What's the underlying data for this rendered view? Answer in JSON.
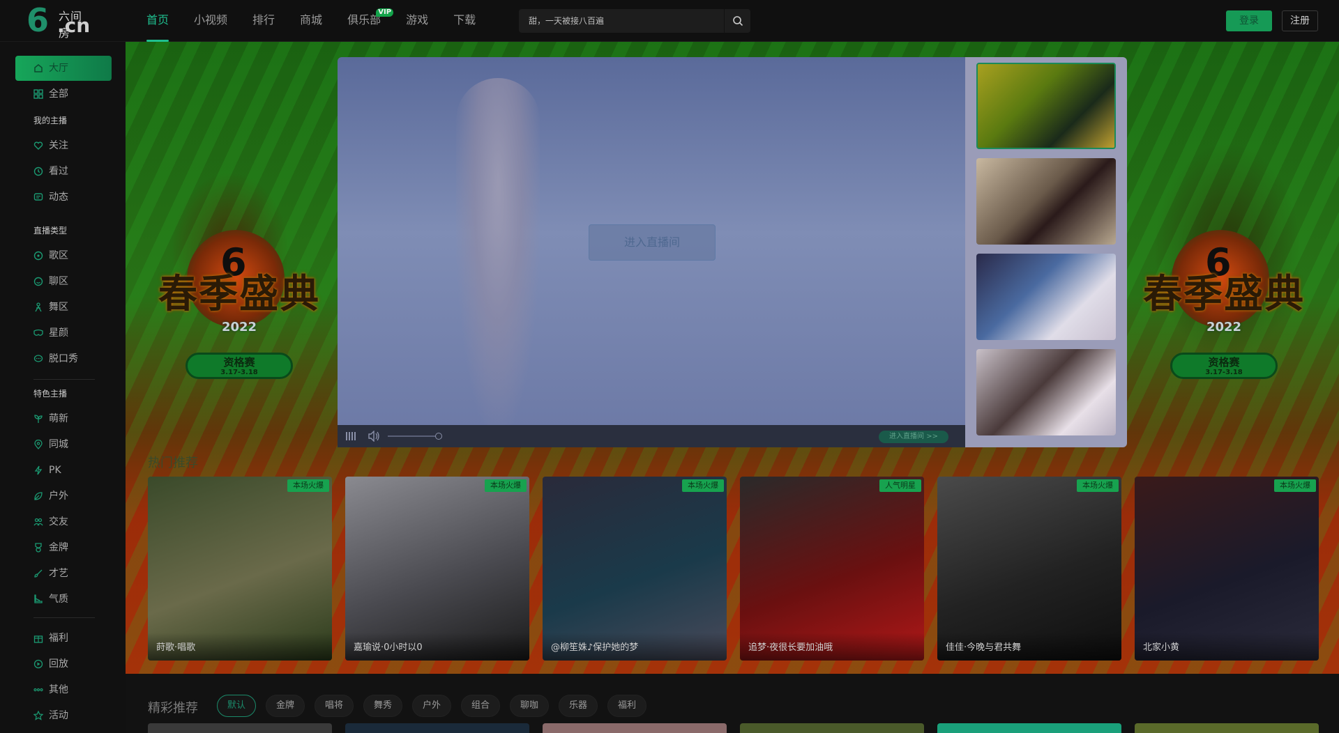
{
  "header": {
    "logo": {
      "top": "六间房",
      "bottom": "6.cn"
    },
    "nav": [
      {
        "label": "首页",
        "active": true
      },
      {
        "label": "小视频"
      },
      {
        "label": "排行"
      },
      {
        "label": "商城"
      },
      {
        "label": "俱乐部",
        "badge": "VIP"
      },
      {
        "label": "游戏"
      },
      {
        "label": "下载"
      }
    ],
    "search_placeholder": "甜，一天被接八百遍",
    "login_label": "登录",
    "register_label": "注册"
  },
  "sidebar": {
    "items_top": [
      {
        "label": "大厅",
        "icon": "home-icon",
        "active": true
      },
      {
        "label": "全部",
        "icon": "grid-icon"
      }
    ],
    "section_my": "我的主播",
    "items_my": [
      {
        "label": "关注",
        "icon": "heart-icon"
      },
      {
        "label": "看过",
        "icon": "clock-icon"
      },
      {
        "label": "动态",
        "icon": "chat-icon"
      }
    ],
    "section_type": "直播类型",
    "items_type": [
      {
        "label": "歌区",
        "icon": "music-disc-icon"
      },
      {
        "label": "聊区",
        "icon": "smile-icon"
      },
      {
        "label": "舞区",
        "icon": "dance-icon"
      },
      {
        "label": "星颜",
        "icon": "mask-icon"
      },
      {
        "label": "脱口秀",
        "icon": "talk-icon"
      }
    ],
    "section_special": "特色主播",
    "items_special": [
      {
        "label": "萌新",
        "icon": "sprout-icon"
      },
      {
        "label": "同城",
        "icon": "location-icon"
      },
      {
        "label": "PK",
        "icon": "lightning-icon"
      },
      {
        "label": "户外",
        "icon": "leaf-icon"
      },
      {
        "label": "交友",
        "icon": "users-icon"
      },
      {
        "label": "金牌",
        "icon": "medal-icon"
      },
      {
        "label": "才艺",
        "icon": "brush-icon"
      },
      {
        "label": "气质",
        "icon": "shoe-icon"
      }
    ],
    "items_bottom": [
      {
        "label": "福利",
        "icon": "gift-icon"
      },
      {
        "label": "回放",
        "icon": "replay-icon"
      },
      {
        "label": "其他",
        "icon": "more-icon"
      },
      {
        "label": "活动",
        "icon": "star-icon"
      }
    ]
  },
  "hero": {
    "event_title": "春季盛典",
    "event_year": "2022",
    "event_stage": "资格赛",
    "event_dates": "3.17-3.18",
    "enter_room_label": "进入直播间",
    "go_room_label": "进入直播间 >>"
  },
  "featured": {
    "title": "热门推荐",
    "cards": [
      {
        "name": "莳歌·唱歌",
        "tag": "本场火爆",
        "colors": [
          "#3a4a2a",
          "#6a6a4a",
          "#2a3a1a"
        ]
      },
      {
        "name": "嘉瑜说·0小时以0",
        "tag": "本场火爆",
        "colors": [
          "#8a8a90",
          "#4a4a50",
          "#1a1a1a"
        ]
      },
      {
        "name": "@柳笙姝♪保护她的梦",
        "tag": "本场火爆",
        "colors": [
          "#2a2a3a",
          "#1a3a4a",
          "#4a4a5a"
        ]
      },
      {
        "name": "追梦·夜很长要加油哦",
        "tag": "人气明星",
        "colors": [
          "#2a2a2a",
          "#6a1010",
          "#b01818"
        ]
      },
      {
        "name": "佳佳·今晚与君共舞",
        "tag": "本场火爆",
        "colors": [
          "#4a4a4a",
          "#222",
          "#0e0e0e"
        ]
      },
      {
        "name": "北家小黄",
        "tag": "本场火爆",
        "colors": [
          "#3a1a1a",
          "#1a1a2a",
          "#2a2a3a"
        ]
      }
    ]
  },
  "recommend": {
    "title": "精彩推荐",
    "chips": [
      {
        "label": "默认",
        "active": true
      },
      {
        "label": "金牌"
      },
      {
        "label": "唱将"
      },
      {
        "label": "舞秀"
      },
      {
        "label": "户外"
      },
      {
        "label": "组合"
      },
      {
        "label": "聊咖"
      },
      {
        "label": "乐器"
      },
      {
        "label": "福利"
      }
    ]
  }
}
